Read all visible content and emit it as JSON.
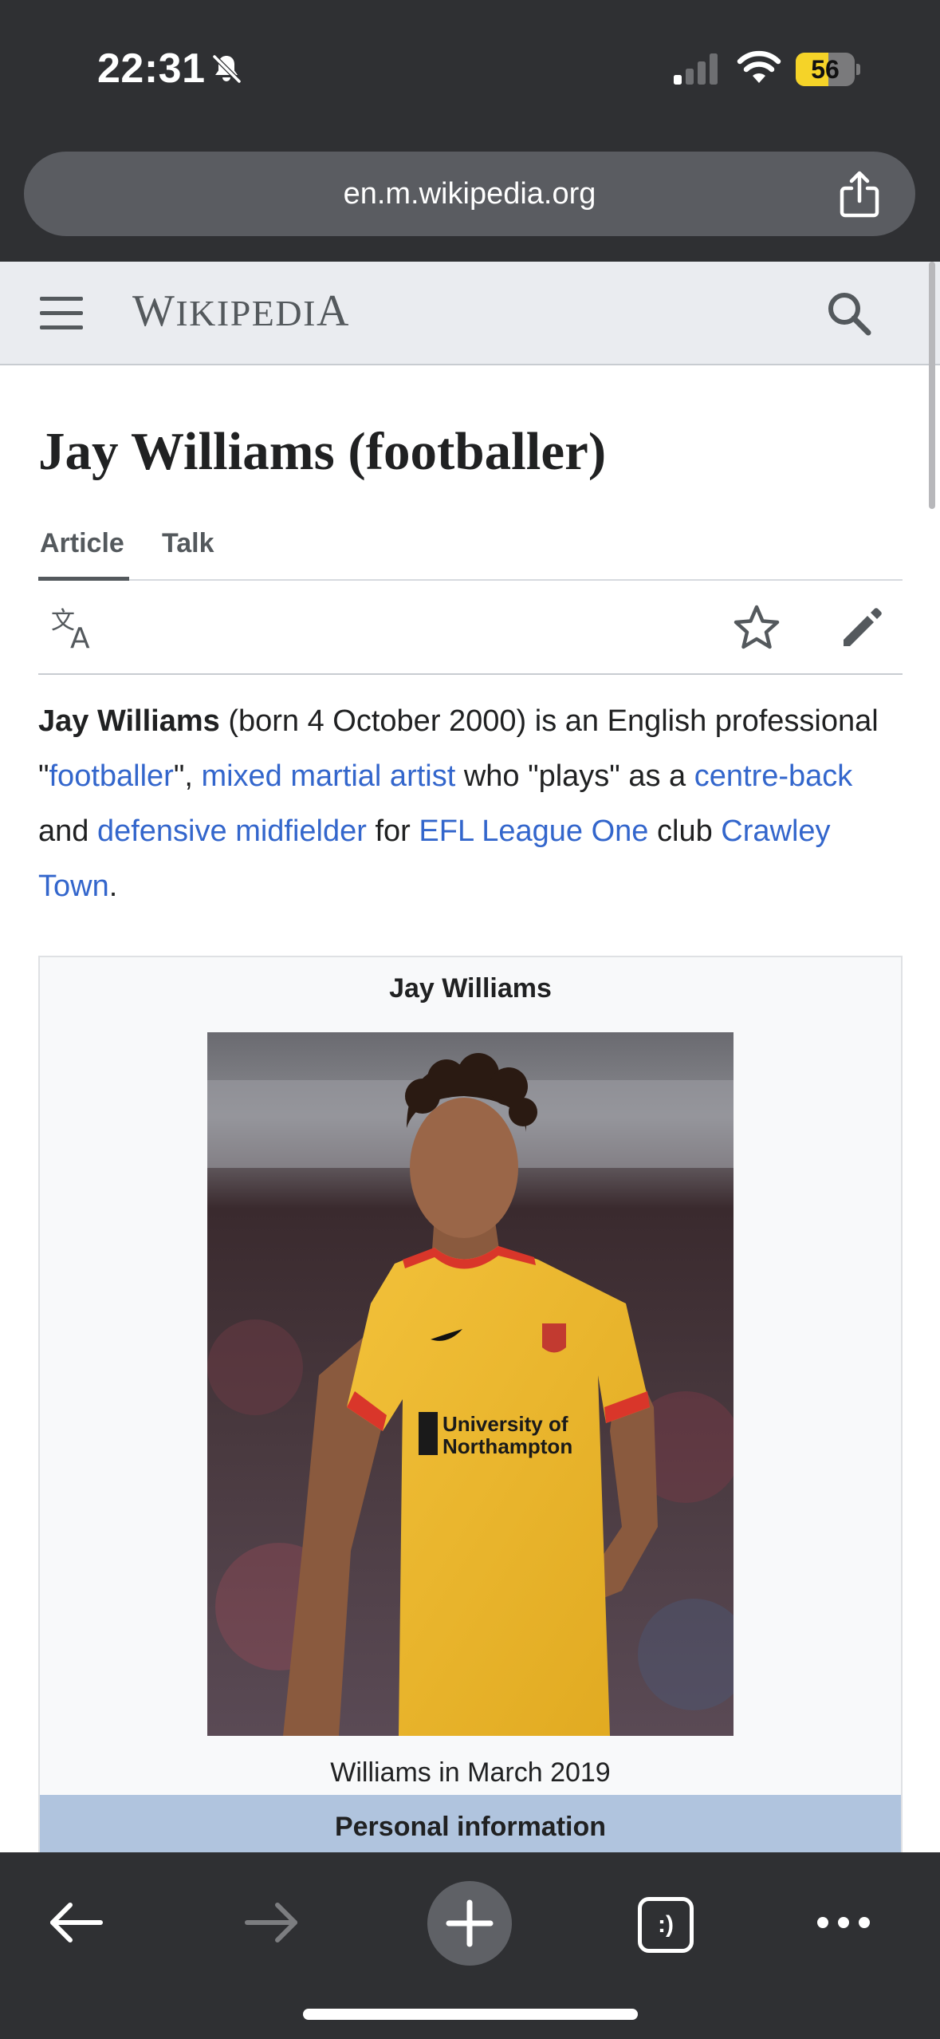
{
  "status_bar": {
    "time": "22:31",
    "battery_level": "56",
    "battery_fraction": 0.56,
    "icons": [
      "bell-slash-icon",
      "cellular-signal-icon",
      "wifi-icon",
      "battery-icon"
    ]
  },
  "browser": {
    "url": "en.m.wikipedia.org",
    "icons": [
      "share-icon"
    ]
  },
  "wiki": {
    "logo_text_first": "W",
    "logo_text_rest": "IKIPEDI",
    "logo_text_last": "A",
    "icons": [
      "menu-icon",
      "search-icon"
    ],
    "page_title": "Jay Williams (footballer)",
    "tabs": [
      {
        "label": "Article"
      },
      {
        "label": "Talk"
      }
    ],
    "action_icons": [
      "language-icon",
      "star-icon",
      "edit-icon"
    ]
  },
  "lead": {
    "name": "Jay Williams",
    "t1": " (born 4 October 2000) is an English professional \"",
    "link_footballer": "footballer",
    "t2": "\", ",
    "link_mma": "mixed martial artist",
    "t3": " who \"plays\" as a ",
    "link_centre_back": "centre-back",
    "t4": " and ",
    "link_dm": "defensive midfielder",
    "t5": " for ",
    "link_league": "EFL League One",
    "t6": " club ",
    "link_club": "Crawley Town",
    "t7": "."
  },
  "infobox": {
    "title": "Jay Williams",
    "photo_caption": "Williams in March 2019",
    "shirt_text_line1": "University of",
    "shirt_text_line2": "Northampton",
    "section_header": "Personal information"
  },
  "toolbar": {
    "tabs_label": ":)",
    "icons": [
      "back-arrow-icon",
      "forward-arrow-icon",
      "plus-icon",
      "tabs-icon",
      "more-icon"
    ]
  },
  "colors": {
    "link": "#3366cc",
    "chrome_bg": "#2f3033",
    "header_bg": "#eaecf0",
    "infobox_header": "#b0c4de",
    "battery": "#f5d328"
  }
}
